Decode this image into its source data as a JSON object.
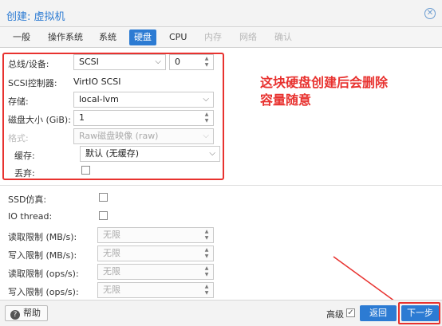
{
  "window": {
    "title": "创建: 虚拟机"
  },
  "tabs": [
    {
      "label": "一般",
      "state": "normal"
    },
    {
      "label": "操作系统",
      "state": "normal"
    },
    {
      "label": "系统",
      "state": "normal"
    },
    {
      "label": "硬盘",
      "state": "active"
    },
    {
      "label": "CPU",
      "state": "normal"
    },
    {
      "label": "内存",
      "state": "disabled"
    },
    {
      "label": "网络",
      "state": "disabled"
    },
    {
      "label": "确认",
      "state": "disabled"
    }
  ],
  "form": {
    "bus_label": "总线/设备:",
    "bus_value": "SCSI",
    "device_index": "0",
    "scsi_label": "SCSI控制器:",
    "scsi_value": "VirtIO SCSI",
    "storage_label": "存储:",
    "storage_value": "local-lvm",
    "size_label": "磁盘大小 (GiB):",
    "size_value": "1",
    "format_label": "格式:",
    "format_value": "Raw磁盘映像 (raw)",
    "cache_label": "缓存:",
    "cache_value": "默认 (无缓存)",
    "discard_label": "丢弃:",
    "ssd_label": "SSD仿真:",
    "iothread_label": "IO thread:",
    "read_mb_label": "读取限制 (MB/s):",
    "read_mb_placeholder": "无限",
    "write_mb_label": "写入限制 (MB/s):",
    "write_mb_placeholder": "无限",
    "read_ops_label": "读取限制 (ops/s):",
    "read_ops_placeholder": "无限",
    "write_ops_label": "写入限制 (ops/s):",
    "write_ops_placeholder": "无限"
  },
  "annotation": {
    "text_line1": "这块硬盘创建后会删除",
    "text_line2": "容量随意",
    "color": "#e8322f"
  },
  "footer": {
    "help_label": "帮助",
    "advanced_label": "高级",
    "advanced_checked": true,
    "back_label": "返回",
    "next_label": "下一步"
  },
  "colors": {
    "accent": "#2c7bd3",
    "annotation": "#e8322f"
  }
}
